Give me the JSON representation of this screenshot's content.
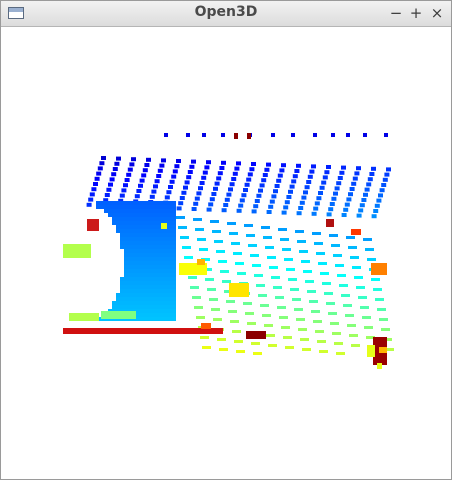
{
  "window": {
    "title": "Open3D",
    "controls": {
      "minimize": "−",
      "maximize": "+",
      "close": "×"
    }
  },
  "point_cloud": {
    "colormap": "jet",
    "background_color": "#ffffff"
  }
}
